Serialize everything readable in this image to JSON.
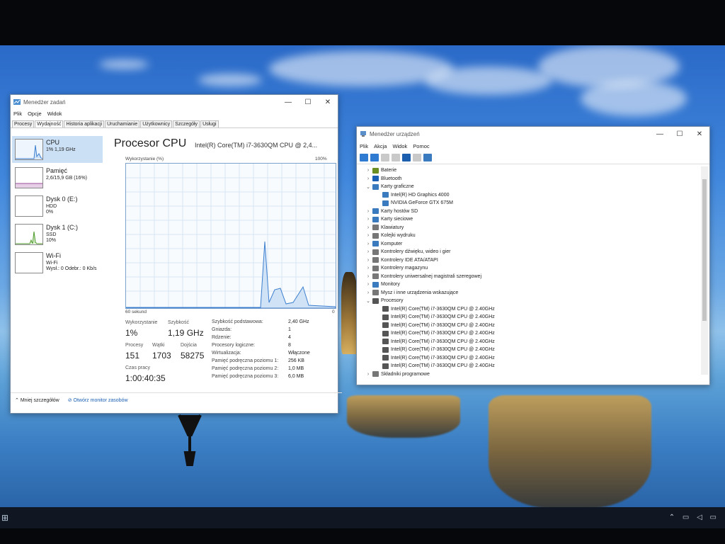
{
  "task_manager": {
    "title": "Menedżer zadań",
    "menu": [
      "Plik",
      "Opcje",
      "Widok"
    ],
    "tabs": [
      "Procesy",
      "Wydajność",
      "Historia aplikacji",
      "Uruchamianie",
      "Użytkownicy",
      "Szczegóły",
      "Usługi"
    ],
    "active_tab": "Wydajność",
    "sidebar": [
      {
        "name": "CPU",
        "line2": "1% 1,19 GHz",
        "line3": ""
      },
      {
        "name": "Pamięć",
        "line2": "2,6/15,9 GB (16%)",
        "line3": ""
      },
      {
        "name": "Dysk 0 (E:)",
        "line2": "HDD",
        "line3": "0%"
      },
      {
        "name": "Dysk 1 (C:)",
        "line2": "SSD",
        "line3": "10%"
      },
      {
        "name": "Wi-Fi",
        "line2": "Wi-Fi",
        "line3": "Wysł.: 0 Odebr.: 0 Kb/s"
      }
    ],
    "main": {
      "title": "Procesor CPU",
      "model": "Intel(R) Core(TM) i7-3630QM CPU @ 2,4...",
      "graph_label": "Wykorzystanie (%)",
      "graph_max": "100%",
      "graph_time": "60 sekund",
      "graph_min": "0",
      "stats": {
        "util_label": "Wykorzystanie",
        "util_value": "1%",
        "speed_label": "Szybkość",
        "speed_value": "1,19 GHz",
        "proc_label": "Procesy",
        "proc_value": "151",
        "threads_label": "Wątki",
        "threads_value": "1703",
        "handles_label": "Dojścia",
        "handles_value": "58275",
        "uptime_label": "Czas pracy",
        "uptime_value": "1:00:40:35"
      },
      "info": [
        {
          "label": "Szybkość podstawowa:",
          "value": "2,40 GHz"
        },
        {
          "label": "Gniazda:",
          "value": "1"
        },
        {
          "label": "Rdzenie:",
          "value": "4"
        },
        {
          "label": "Procesory logiczne:",
          "value": "8"
        },
        {
          "label": "Wirtualizacja:",
          "value": "Włączone"
        },
        {
          "label": "Pamięć podręczna poziomu 1:",
          "value": "256 KB"
        },
        {
          "label": "Pamięć podręczna poziomu 2:",
          "value": "1,0 MB"
        },
        {
          "label": "Pamięć podręczna poziomu 3:",
          "value": "6,0 MB"
        }
      ]
    },
    "footer": {
      "less": "Mniej szczegółów",
      "monitor": "Otwórz monitor zasobów"
    }
  },
  "device_manager": {
    "title": "Menedżer urządzeń",
    "menu": [
      "Plik",
      "Akcja",
      "Widok",
      "Pomoc"
    ],
    "tree": [
      {
        "label": "Baterie",
        "level": 1,
        "expanded": false,
        "icon_color": "#6b8e23"
      },
      {
        "label": "Bluetooth",
        "level": 1,
        "expanded": false,
        "icon_color": "#1a5fb4"
      },
      {
        "label": "Karty graficzne",
        "level": 1,
        "expanded": true,
        "icon_color": "#3a7bbf"
      },
      {
        "label": "Intel(R) HD Graphics 4000",
        "level": 2,
        "icon_color": "#3a7bbf"
      },
      {
        "label": "NVIDIA GeForce GTX 675M",
        "level": 2,
        "icon_color": "#3a7bbf"
      },
      {
        "label": "Karty hostów SD",
        "level": 1,
        "expanded": false,
        "icon_color": "#3a7bbf"
      },
      {
        "label": "Karty sieciowe",
        "level": 1,
        "expanded": false,
        "icon_color": "#3a7bbf"
      },
      {
        "label": "Klawiatury",
        "level": 1,
        "expanded": false,
        "icon_color": "#777"
      },
      {
        "label": "Kolejki wydruku",
        "level": 1,
        "expanded": false,
        "icon_color": "#777"
      },
      {
        "label": "Komputer",
        "level": 1,
        "expanded": false,
        "icon_color": "#3a7bbf"
      },
      {
        "label": "Kontrolery dźwięku, wideo i gier",
        "level": 1,
        "expanded": false,
        "icon_color": "#777"
      },
      {
        "label": "Kontrolery IDE ATA/ATAPI",
        "level": 1,
        "expanded": false,
        "icon_color": "#777"
      },
      {
        "label": "Kontrolery magazynu",
        "level": 1,
        "expanded": false,
        "icon_color": "#777"
      },
      {
        "label": "Kontrolery uniwersalnej magistrali szeregowej",
        "level": 1,
        "expanded": false,
        "icon_color": "#777"
      },
      {
        "label": "Monitory",
        "level": 1,
        "expanded": false,
        "icon_color": "#3a7bbf"
      },
      {
        "label": "Mysz i inne urządzenia wskazujące",
        "level": 1,
        "expanded": false,
        "icon_color": "#777"
      },
      {
        "label": "Procesory",
        "level": 1,
        "expanded": true,
        "icon_color": "#555"
      },
      {
        "label": "Intel(R) Core(TM) i7-3630QM CPU @ 2.40GHz",
        "level": 2,
        "icon_color": "#555"
      },
      {
        "label": "Intel(R) Core(TM) i7-3630QM CPU @ 2.40GHz",
        "level": 2,
        "icon_color": "#555"
      },
      {
        "label": "Intel(R) Core(TM) i7-3630QM CPU @ 2.40GHz",
        "level": 2,
        "icon_color": "#555"
      },
      {
        "label": "Intel(R) Core(TM) i7-3630QM CPU @ 2.40GHz",
        "level": 2,
        "icon_color": "#555"
      },
      {
        "label": "Intel(R) Core(TM) i7-3630QM CPU @ 2.40GHz",
        "level": 2,
        "icon_color": "#555"
      },
      {
        "label": "Intel(R) Core(TM) i7-3630QM CPU @ 2.40GHz",
        "level": 2,
        "icon_color": "#555"
      },
      {
        "label": "Intel(R) Core(TM) i7-3630QM CPU @ 2.40GHz",
        "level": 2,
        "icon_color": "#555"
      },
      {
        "label": "Intel(R) Core(TM) i7-3630QM CPU @ 2.40GHz",
        "level": 2,
        "icon_color": "#555"
      },
      {
        "label": "Składniki programowe",
        "level": 1,
        "expanded": false,
        "icon_color": "#777"
      }
    ]
  }
}
